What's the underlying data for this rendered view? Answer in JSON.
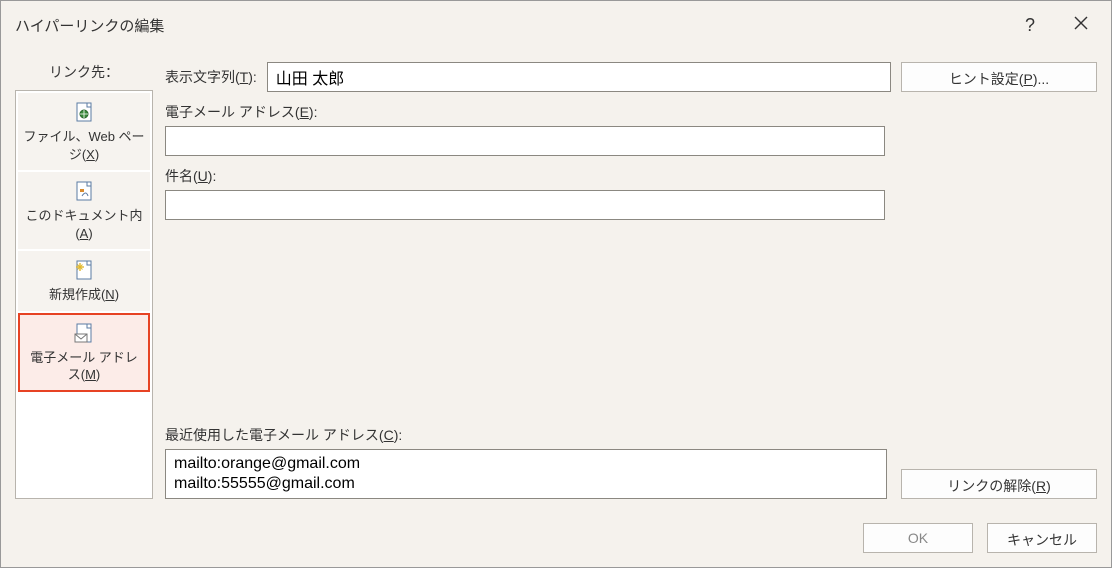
{
  "dialog": {
    "title": "ハイパーリンクの編集"
  },
  "sidebar": {
    "label": "リンク先：",
    "items": [
      {
        "label_html": "ファイル、Web ページ(<u>X</u>)"
      },
      {
        "label_html": "このドキュメント内(<u>A</u>)"
      },
      {
        "label_html": "新規作成(<u>N</u>)"
      },
      {
        "label_html": "電子メール アドレス(<u>M</u>)"
      }
    ]
  },
  "main": {
    "display_text_label_html": "表示文字列(<u>T</u>):",
    "display_text_value": "山田 太郎",
    "hint_button_html": "ヒント設定(<u>P</u>)...",
    "email_label_html": "電子メール アドレス(<u>E</u>):",
    "email_value": "",
    "subject_label_html": "件名(<u>U</u>):",
    "subject_value": "",
    "recent_label_html": "最近使用した電子メール アドレス(<u>C</u>):",
    "recent_items": [
      "mailto:orange@gmail.com",
      "mailto:55555@gmail.com"
    ],
    "remove_link_html": "リンクの解除(<u>R</u>)"
  },
  "buttons": {
    "ok": "OK",
    "cancel": "キャンセル"
  }
}
